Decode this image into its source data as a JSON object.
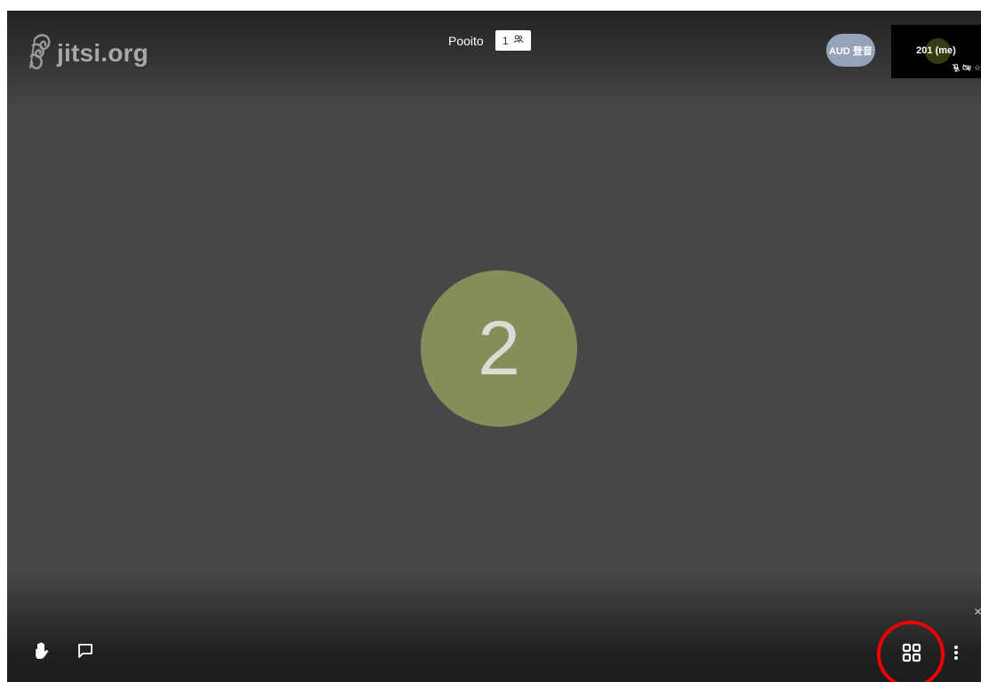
{
  "watermark": {
    "text": "jitsi.org",
    "icon": "jitsi-logo-icon"
  },
  "header": {
    "subject": "Pooito",
    "participant_count": "1",
    "participant_icon": "participants-icon"
  },
  "filmstrip": {
    "remote_participant_label": "AUD 登音",
    "local_participant_label": "201 (me)",
    "local_status_icons": [
      "microphone-muted-icon",
      "camera-muted-icon",
      "star-icon"
    ]
  },
  "main": {
    "avatar_text": "2",
    "avatar_color": "#858d5b"
  },
  "toolbar": {
    "left_buttons": [
      "raise-hand-icon",
      "chat-icon"
    ],
    "right_buttons": [
      "tile-view-icon",
      "more-actions-icon"
    ],
    "highlight_color": "#f00000"
  },
  "colors": {
    "background": "#474747",
    "text": "#ffffff",
    "remote_thumbnail": "#95a2b7"
  },
  "edge_close_glyph": "×"
}
